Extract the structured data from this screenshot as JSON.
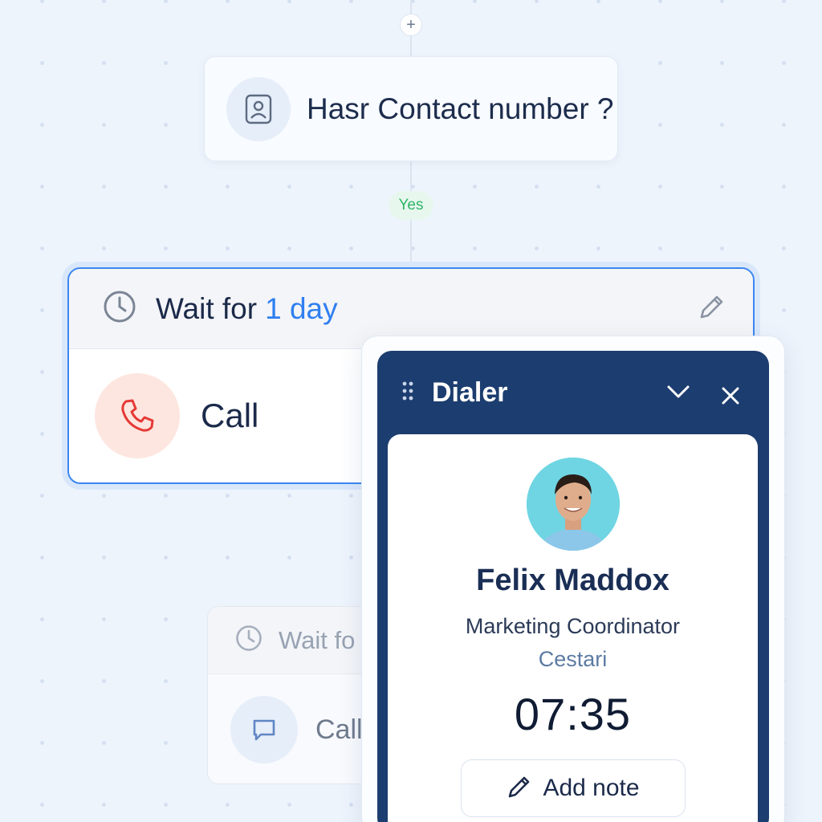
{
  "flow": {
    "add_node_symbol": "+",
    "condition": {
      "title": "Hasr Contact number ?",
      "icon": "contact-card-icon"
    },
    "branch_label": "Yes",
    "wait_step": {
      "prefix": "Wait for",
      "duration": "1 day",
      "action_label": "Call",
      "accent_color": "#3c86f0",
      "call_icon_color": "#e53935"
    },
    "faded_step": {
      "prefix": "Wait fo",
      "action_label": "Call"
    }
  },
  "dialer": {
    "title": "Dialer",
    "header_color": "#1c3d6f",
    "contact": {
      "name": "Felix Maddox",
      "role": "Marketing Coordinator",
      "company": "Cestari"
    },
    "timer": "07:35",
    "add_note_label": "Add note"
  }
}
